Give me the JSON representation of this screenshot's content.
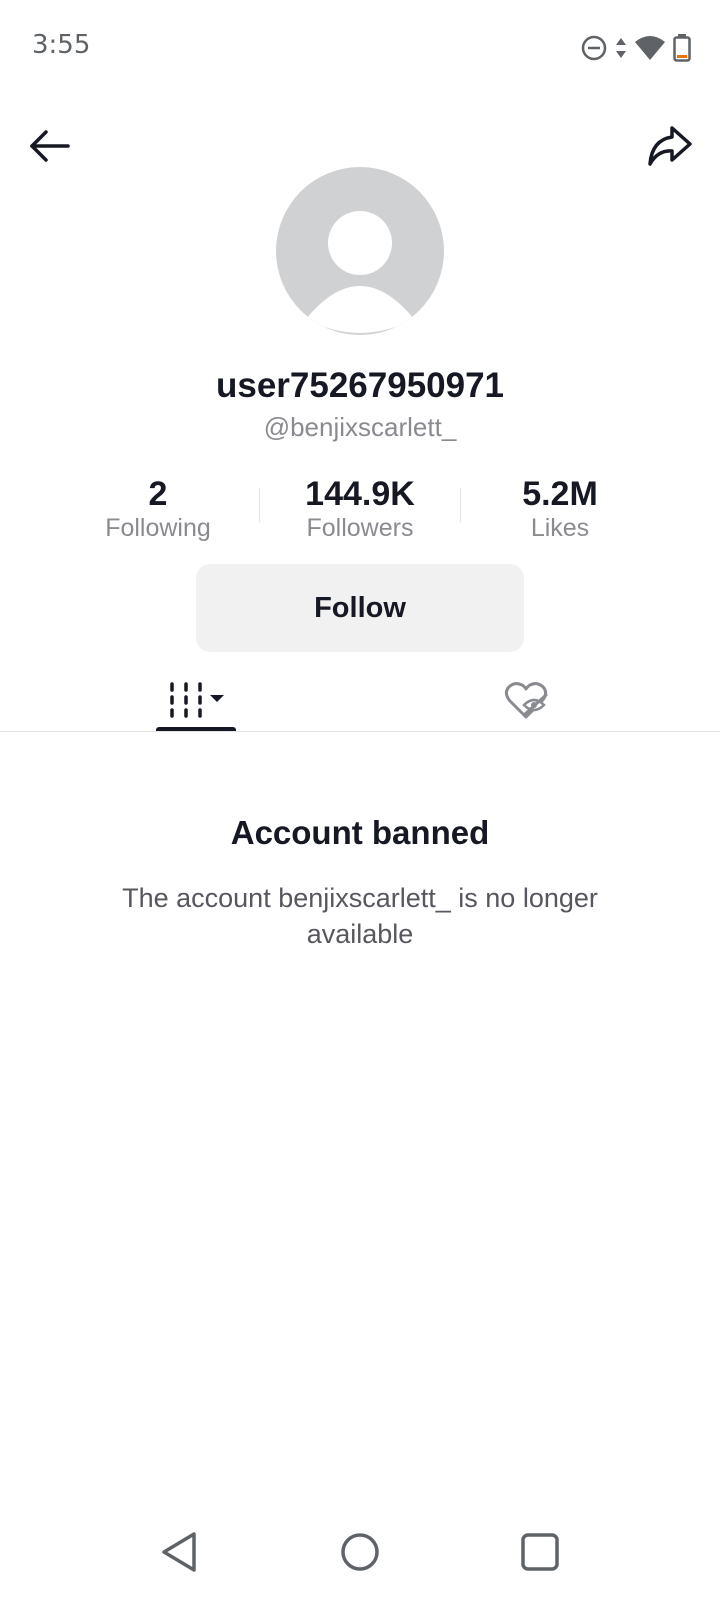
{
  "status_bar": {
    "time": "3:55",
    "icons": [
      "dnd-icon",
      "data-arrows-icon",
      "wifi-icon",
      "battery-icon"
    ]
  },
  "top_bar": {
    "back_icon": "arrow-left-icon",
    "share_icon": "share-arrow-icon"
  },
  "profile": {
    "avatar_icon": "default-avatar-icon",
    "username": "user75267950971",
    "handle": "@benjixscarlett_",
    "stats": {
      "following": {
        "value": "2",
        "label": "Following"
      },
      "followers": {
        "value": "144.9K",
        "label": "Followers"
      },
      "likes": {
        "value": "5.2M",
        "label": "Likes"
      }
    },
    "follow_button": "Follow"
  },
  "tabs": {
    "videos_icon": "videos-grid-icon",
    "liked_icon": "liked-hidden-icon",
    "selected": "videos"
  },
  "message": {
    "title": "Account banned",
    "body": "The account benjixscarlett_ is no longer available"
  },
  "nav_bar": {
    "back": "nav-back-icon",
    "home": "nav-home-icon",
    "recents": "nav-recents-icon"
  },
  "colors": {
    "text_primary": "#161823",
    "text_secondary": "#8a8b91",
    "button_bg": "#f1f1f2",
    "avatar_bg": "#d0d1d3"
  }
}
